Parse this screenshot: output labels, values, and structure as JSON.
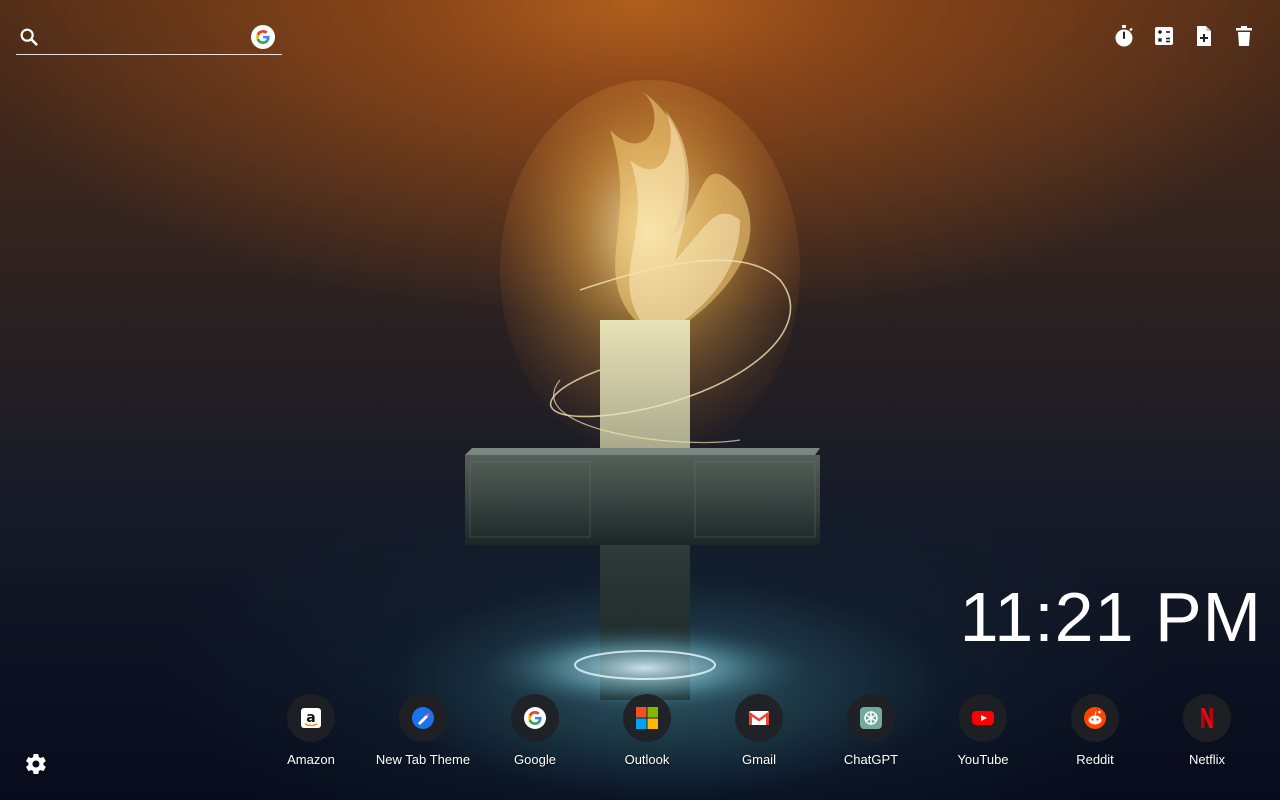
{
  "search": {
    "placeholder": "",
    "search_icon": "search-icon",
    "engine_icon": "google-g-icon"
  },
  "toolbar": {
    "items": [
      {
        "icon": "stopwatch-icon"
      },
      {
        "icon": "calculator-icon"
      },
      {
        "icon": "add-note-icon"
      },
      {
        "icon": "trash-icon"
      }
    ]
  },
  "clock": {
    "time": "11:21 PM"
  },
  "shortcuts": [
    {
      "label": "Amazon",
      "icon": "amazon-icon"
    },
    {
      "label": "New Tab Theme",
      "icon": "new-tab-theme-icon"
    },
    {
      "label": "Google",
      "icon": "google-icon"
    },
    {
      "label": "Outlook",
      "icon": "microsoft-icon"
    },
    {
      "label": "Gmail",
      "icon": "gmail-icon"
    },
    {
      "label": "ChatGPT",
      "icon": "chatgpt-icon"
    },
    {
      "label": "YouTube",
      "icon": "youtube-icon"
    },
    {
      "label": "Reddit",
      "icon": "reddit-icon"
    },
    {
      "label": "Netflix",
      "icon": "netflix-icon"
    }
  ],
  "settings": {
    "icon": "gear-icon"
  },
  "background": {
    "subject": "flaming-cross-wallpaper"
  }
}
